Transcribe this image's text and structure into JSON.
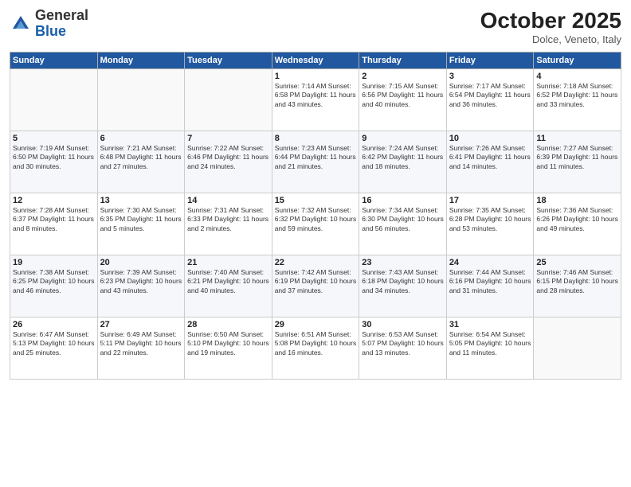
{
  "header": {
    "logo": {
      "general": "General",
      "blue": "Blue"
    },
    "title": "October 2025",
    "subtitle": "Dolce, Veneto, Italy"
  },
  "weekdays": [
    "Sunday",
    "Monday",
    "Tuesday",
    "Wednesday",
    "Thursday",
    "Friday",
    "Saturday"
  ],
  "weeks": [
    [
      {
        "day": "",
        "content": ""
      },
      {
        "day": "",
        "content": ""
      },
      {
        "day": "",
        "content": ""
      },
      {
        "day": "1",
        "content": "Sunrise: 7:14 AM\nSunset: 6:58 PM\nDaylight: 11 hours\nand 43 minutes."
      },
      {
        "day": "2",
        "content": "Sunrise: 7:15 AM\nSunset: 6:56 PM\nDaylight: 11 hours\nand 40 minutes."
      },
      {
        "day": "3",
        "content": "Sunrise: 7:17 AM\nSunset: 6:54 PM\nDaylight: 11 hours\nand 36 minutes."
      },
      {
        "day": "4",
        "content": "Sunrise: 7:18 AM\nSunset: 6:52 PM\nDaylight: 11 hours\nand 33 minutes."
      }
    ],
    [
      {
        "day": "5",
        "content": "Sunrise: 7:19 AM\nSunset: 6:50 PM\nDaylight: 11 hours\nand 30 minutes."
      },
      {
        "day": "6",
        "content": "Sunrise: 7:21 AM\nSunset: 6:48 PM\nDaylight: 11 hours\nand 27 minutes."
      },
      {
        "day": "7",
        "content": "Sunrise: 7:22 AM\nSunset: 6:46 PM\nDaylight: 11 hours\nand 24 minutes."
      },
      {
        "day": "8",
        "content": "Sunrise: 7:23 AM\nSunset: 6:44 PM\nDaylight: 11 hours\nand 21 minutes."
      },
      {
        "day": "9",
        "content": "Sunrise: 7:24 AM\nSunset: 6:42 PM\nDaylight: 11 hours\nand 18 minutes."
      },
      {
        "day": "10",
        "content": "Sunrise: 7:26 AM\nSunset: 6:41 PM\nDaylight: 11 hours\nand 14 minutes."
      },
      {
        "day": "11",
        "content": "Sunrise: 7:27 AM\nSunset: 6:39 PM\nDaylight: 11 hours\nand 11 minutes."
      }
    ],
    [
      {
        "day": "12",
        "content": "Sunrise: 7:28 AM\nSunset: 6:37 PM\nDaylight: 11 hours\nand 8 minutes."
      },
      {
        "day": "13",
        "content": "Sunrise: 7:30 AM\nSunset: 6:35 PM\nDaylight: 11 hours\nand 5 minutes."
      },
      {
        "day": "14",
        "content": "Sunrise: 7:31 AM\nSunset: 6:33 PM\nDaylight: 11 hours\nand 2 minutes."
      },
      {
        "day": "15",
        "content": "Sunrise: 7:32 AM\nSunset: 6:32 PM\nDaylight: 10 hours\nand 59 minutes."
      },
      {
        "day": "16",
        "content": "Sunrise: 7:34 AM\nSunset: 6:30 PM\nDaylight: 10 hours\nand 56 minutes."
      },
      {
        "day": "17",
        "content": "Sunrise: 7:35 AM\nSunset: 6:28 PM\nDaylight: 10 hours\nand 53 minutes."
      },
      {
        "day": "18",
        "content": "Sunrise: 7:36 AM\nSunset: 6:26 PM\nDaylight: 10 hours\nand 49 minutes."
      }
    ],
    [
      {
        "day": "19",
        "content": "Sunrise: 7:38 AM\nSunset: 6:25 PM\nDaylight: 10 hours\nand 46 minutes."
      },
      {
        "day": "20",
        "content": "Sunrise: 7:39 AM\nSunset: 6:23 PM\nDaylight: 10 hours\nand 43 minutes."
      },
      {
        "day": "21",
        "content": "Sunrise: 7:40 AM\nSunset: 6:21 PM\nDaylight: 10 hours\nand 40 minutes."
      },
      {
        "day": "22",
        "content": "Sunrise: 7:42 AM\nSunset: 6:19 PM\nDaylight: 10 hours\nand 37 minutes."
      },
      {
        "day": "23",
        "content": "Sunrise: 7:43 AM\nSunset: 6:18 PM\nDaylight: 10 hours\nand 34 minutes."
      },
      {
        "day": "24",
        "content": "Sunrise: 7:44 AM\nSunset: 6:16 PM\nDaylight: 10 hours\nand 31 minutes."
      },
      {
        "day": "25",
        "content": "Sunrise: 7:46 AM\nSunset: 6:15 PM\nDaylight: 10 hours\nand 28 minutes."
      }
    ],
    [
      {
        "day": "26",
        "content": "Sunrise: 6:47 AM\nSunset: 5:13 PM\nDaylight: 10 hours\nand 25 minutes."
      },
      {
        "day": "27",
        "content": "Sunrise: 6:49 AM\nSunset: 5:11 PM\nDaylight: 10 hours\nand 22 minutes."
      },
      {
        "day": "28",
        "content": "Sunrise: 6:50 AM\nSunset: 5:10 PM\nDaylight: 10 hours\nand 19 minutes."
      },
      {
        "day": "29",
        "content": "Sunrise: 6:51 AM\nSunset: 5:08 PM\nDaylight: 10 hours\nand 16 minutes."
      },
      {
        "day": "30",
        "content": "Sunrise: 6:53 AM\nSunset: 5:07 PM\nDaylight: 10 hours\nand 13 minutes."
      },
      {
        "day": "31",
        "content": "Sunrise: 6:54 AM\nSunset: 5:05 PM\nDaylight: 10 hours\nand 11 minutes."
      },
      {
        "day": "",
        "content": ""
      }
    ]
  ]
}
